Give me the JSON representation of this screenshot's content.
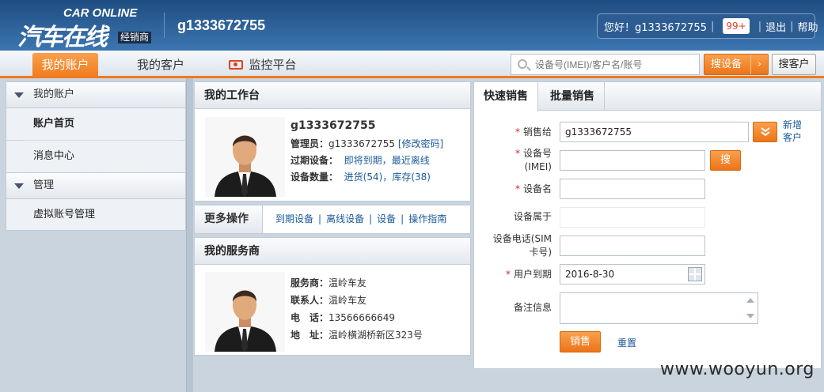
{
  "header": {
    "logo_en": "CAR ONLINE",
    "logo_cn": "汽车在线",
    "logo_tag": "经销商",
    "username": "g1333672755",
    "greeting": "您好！g1333672755",
    "message_count": "99+",
    "logout_label": "退出",
    "help_label": "帮助"
  },
  "nav": {
    "tabs": [
      {
        "label": "我的账户"
      },
      {
        "label": "我的客户"
      },
      {
        "label": "监控平台"
      }
    ],
    "search_placeholder": "设备号(IMEI)/客户名/账号",
    "search_device_label": "搜设备",
    "search_device_arrow": "›",
    "search_customer_label": "搜客户"
  },
  "sidebar": {
    "groups": [
      {
        "title": "我的账户",
        "items": [
          {
            "label": "账户首页"
          },
          {
            "label": "消息中心"
          }
        ]
      },
      {
        "title": "管理",
        "items": [
          {
            "label": "虚拟账号管理"
          }
        ]
      }
    ]
  },
  "workbench": {
    "title": "我的工作台",
    "account": "g1333672755",
    "admin_key": "管理员：",
    "admin_value": "g1333672755",
    "change_password": "[修改密码]",
    "expired_key": "过期设备：",
    "expiring_link": "即将到期",
    "recent_offline_link": "最近离线",
    "count_key": "设备数量：",
    "purchase_link": "进货(54)",
    "stock_link": "库存(38)",
    "comma": "，"
  },
  "more_ops": {
    "label": "更多操作",
    "links": [
      "到期设备",
      "离线设备",
      "设备",
      "操作指南"
    ],
    "separator": "|"
  },
  "provider": {
    "title": "我的服务商",
    "fields": [
      {
        "key": "服务商：",
        "value": "温岭车友"
      },
      {
        "key": "联系人：",
        "value": "温岭车友"
      },
      {
        "key": "电　话：",
        "value": "13566666649"
      },
      {
        "key": "地　址：",
        "value": "温岭横湖桥新区323号"
      }
    ]
  },
  "sale_form": {
    "tabs": [
      {
        "label": "快速销售"
      },
      {
        "label": "批量销售"
      }
    ],
    "required_mark": "*",
    "sell_to_label": "销售给",
    "sell_to_value": "g1333672755",
    "new_customer_link": "新增客户",
    "imei_label": "设备号(IMEI)",
    "imei_value": "",
    "search_btn": "搜",
    "device_name_label": "设备名",
    "device_name_value": "",
    "belongs_label": "设备属于",
    "belongs_value": "",
    "phone_label": "设备电话(SIM卡号)",
    "phone_value": "",
    "expire_label": "用户到期",
    "expire_value": "2016-8-30",
    "remark_label": "备注信息",
    "remark_value": "",
    "submit_label": "销售",
    "reset_label": "重置"
  },
  "watermark": "www.wooyun.org",
  "colors": {
    "header_blue": "#2c5c92",
    "accent_orange": "#f07a1c",
    "link_blue": "#1b5a9c",
    "required_red": "#d8262b"
  }
}
